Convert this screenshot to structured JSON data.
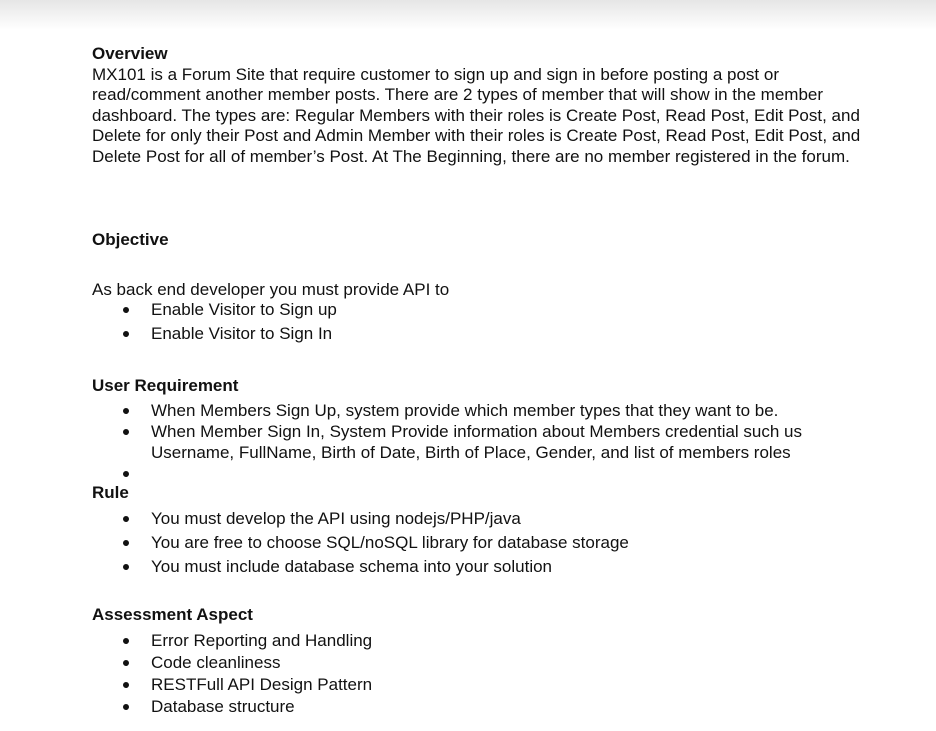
{
  "overview": {
    "heading": "Overview",
    "text": "MX101 is a Forum Site that require customer to sign up and sign in before posting a post or read/comment another member posts. There are 2 types of member that will show in the member dashboard. The types are: Regular Members with their roles is Create Post, Read Post, Edit Post, and Delete for only their Post and Admin Member with their roles is Create Post, Read Post, Edit Post, and Delete Post for all of member’s Post. At The Beginning, there are no member registered in the forum."
  },
  "objective": {
    "heading": "Objective",
    "intro": "As back end developer you must provide API to",
    "items": [
      "Enable Visitor to Sign up",
      "Enable Visitor to Sign In"
    ]
  },
  "user_requirement": {
    "heading": "User Requirement",
    "items": [
      "When Members Sign Up, system provide which member types that they want to be.",
      "When Member Sign In, System Provide information about Members credential such us Username, FullName, Birth of Date, Birth of Place, Gender, and list of members roles",
      ""
    ]
  },
  "rule": {
    "heading": "Rule",
    "items": [
      "You must develop the API using nodejs/PHP/java",
      "You are free to choose SQL/noSQL library for database storage",
      "You must include database schema into your solution"
    ]
  },
  "assessment": {
    "heading": "Assessment Aspect",
    "items": [
      "Error Reporting and Handling",
      "Code cleanliness",
      "RESTFull API Design Pattern",
      "Database structure"
    ]
  }
}
